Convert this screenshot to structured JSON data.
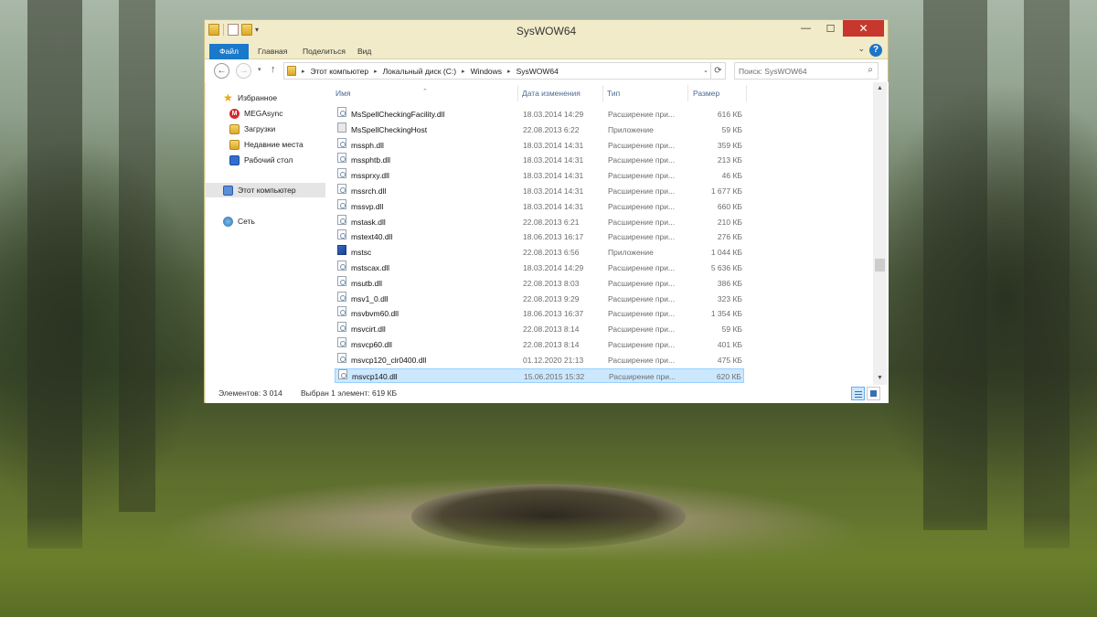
{
  "window": {
    "title": "SysWOW64",
    "minimize_glyph": "—",
    "maximize_glyph": "☐",
    "close_glyph": "✕"
  },
  "ribbon": {
    "tabs": [
      "Файл",
      "Главная",
      "Поделиться",
      "Вид"
    ],
    "collapse_glyph": "⌄",
    "help_glyph": "?"
  },
  "address_bar": {
    "back_glyph": "←",
    "forward_glyph": "→",
    "history_glyph": "▾",
    "up_glyph": "↑",
    "breadcrumbs": [
      "Этот компьютер",
      "Локальный диск (C:)",
      "Windows",
      "SysWOW64"
    ],
    "crumb_separator": "▸",
    "dropdown_glyph": "⌄",
    "refresh_glyph": "⟳",
    "search_placeholder": "Поиск: SysWOW64",
    "search_glyph": "⌕"
  },
  "nav_pane": {
    "items": [
      {
        "label": "Избранное",
        "icon": "star-icon"
      },
      {
        "label": "MEGAsync",
        "icon": "megasync-icon"
      },
      {
        "label": "Загрузки",
        "icon": "downloads-icon"
      },
      {
        "label": "Недавние места",
        "icon": "recent-places-icon"
      },
      {
        "label": "Рабочий стол",
        "icon": "desktop-icon"
      },
      {
        "label": "Этот компьютер",
        "icon": "computer-icon"
      },
      {
        "label": "Сеть",
        "icon": "network-icon"
      }
    ]
  },
  "columns": {
    "name": "Имя",
    "date": "Дата изменения",
    "type": "Тип",
    "size": "Размер"
  },
  "files": [
    {
      "name": "MsSpellCheckingFacility.dll",
      "date": "18.03.2014 14:29",
      "type": "Расширение при...",
      "size": "616 КБ",
      "icon": "dll-icon"
    },
    {
      "name": "MsSpellCheckingHost",
      "date": "22.08.2013 6:22",
      "type": "Приложение",
      "size": "59 КБ",
      "icon": "app-icon"
    },
    {
      "name": "mssph.dll",
      "date": "18.03.2014 14:31",
      "type": "Расширение при...",
      "size": "359 КБ",
      "icon": "dll-icon"
    },
    {
      "name": "mssphtb.dll",
      "date": "18.03.2014 14:31",
      "type": "Расширение при...",
      "size": "213 КБ",
      "icon": "dll-icon"
    },
    {
      "name": "mssprxy.dll",
      "date": "18.03.2014 14:31",
      "type": "Расширение при...",
      "size": "46 КБ",
      "icon": "dll-icon"
    },
    {
      "name": "mssrch.dll",
      "date": "18.03.2014 14:31",
      "type": "Расширение при...",
      "size": "1 677 КБ",
      "icon": "dll-icon"
    },
    {
      "name": "mssvp.dll",
      "date": "18.03.2014 14:31",
      "type": "Расширение при...",
      "size": "660 КБ",
      "icon": "dll-icon"
    },
    {
      "name": "mstask.dll",
      "date": "22.08.2013 6:21",
      "type": "Расширение при...",
      "size": "210 КБ",
      "icon": "dll-icon"
    },
    {
      "name": "mstext40.dll",
      "date": "18.06.2013 16:17",
      "type": "Расширение при...",
      "size": "276 КБ",
      "icon": "dll-icon"
    },
    {
      "name": "mstsc",
      "date": "22.08.2013 6:56",
      "type": "Приложение",
      "size": "1 044 КБ",
      "icon": "remote-desktop-icon"
    },
    {
      "name": "mstscax.dll",
      "date": "18.03.2014 14:29",
      "type": "Расширение при...",
      "size": "5 636 КБ",
      "icon": "dll-icon"
    },
    {
      "name": "msutb.dll",
      "date": "22.08.2013 8:03",
      "type": "Расширение при...",
      "size": "386 КБ",
      "icon": "dll-icon"
    },
    {
      "name": "msv1_0.dll",
      "date": "22.08.2013 9:29",
      "type": "Расширение при...",
      "size": "323 КБ",
      "icon": "dll-icon"
    },
    {
      "name": "msvbvm60.dll",
      "date": "18.06.2013 16:37",
      "type": "Расширение при...",
      "size": "1 354 КБ",
      "icon": "dll-icon"
    },
    {
      "name": "msvcirt.dll",
      "date": "22.08.2013 8:14",
      "type": "Расширение при...",
      "size": "59 КБ",
      "icon": "dll-icon"
    },
    {
      "name": "msvcp60.dll",
      "date": "22.08.2013 8:14",
      "type": "Расширение при...",
      "size": "401 КБ",
      "icon": "dll-icon"
    },
    {
      "name": "msvcp120_clr0400.dll",
      "date": "01.12.2020 21:13",
      "type": "Расширение при...",
      "size": "475 КБ",
      "icon": "dll-icon"
    },
    {
      "name": "msvcp140.dll",
      "date": "15.06.2015 15:32",
      "type": "Расширение при...",
      "size": "620 КБ",
      "icon": "dll-icon",
      "selected": true
    }
  ],
  "scrollbar": {
    "up_glyph": "▲",
    "down_glyph": "▼"
  },
  "status": {
    "items_count": "Элементов: 3 014",
    "selection": "Выбран 1 элемент: 619 КБ"
  },
  "colors": {
    "accent": "#1979ca",
    "selection": "#cce8ff",
    "close": "#c7372d",
    "window_frame": "#f2ebc9"
  }
}
